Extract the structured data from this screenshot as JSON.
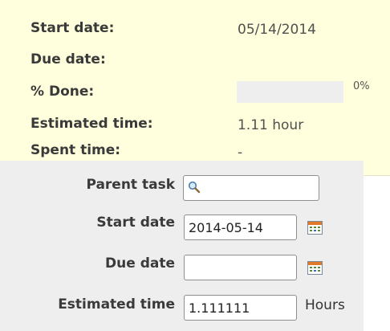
{
  "attributes": {
    "start_date": {
      "label": "Start date:",
      "value": "05/14/2014"
    },
    "due_date": {
      "label": "Due date:",
      "value": ""
    },
    "done": {
      "label": "% Done:",
      "percent_text": "0%",
      "progress": 0
    },
    "estimated_time": {
      "label": "Estimated time:",
      "value": "1.11 hour"
    },
    "spent_time": {
      "label": "Spent time:",
      "value": "-"
    }
  },
  "form": {
    "parent_task": {
      "label": "Parent task",
      "value": "",
      "icon": "magnifier-icon"
    },
    "start_date": {
      "label": "Start date",
      "value": "2014-05-14",
      "icon": "calendar-icon"
    },
    "due_date": {
      "label": "Due date",
      "value": "",
      "icon": "calendar-icon"
    },
    "estimated_time": {
      "label": "Estimated time",
      "value": "1.111111",
      "unit": "Hours"
    }
  },
  "colors": {
    "attributes_background": "#ffffdd",
    "form_background": "#eeeeee",
    "progress_track": "#eeeeee"
  }
}
